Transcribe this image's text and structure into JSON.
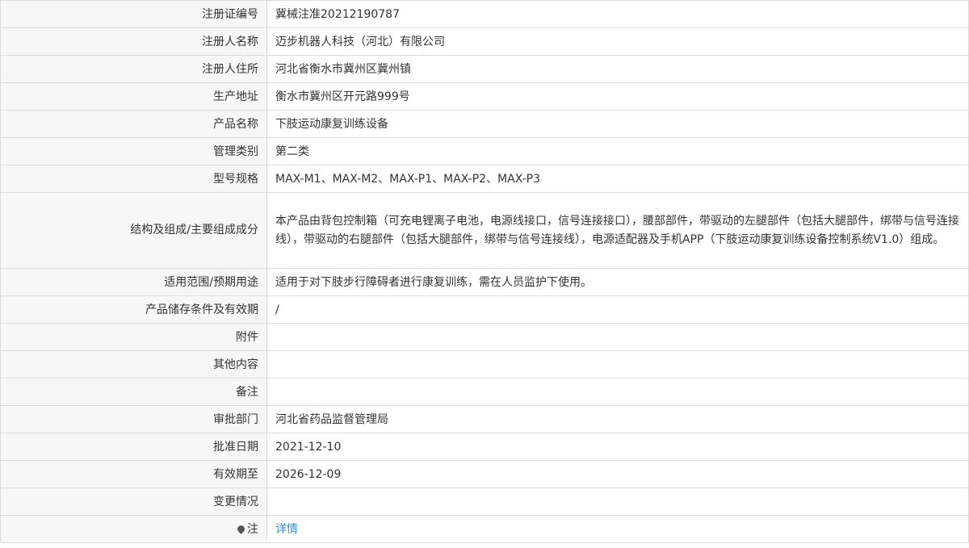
{
  "rows": [
    {
      "label": "注册证编号",
      "value": "冀械注准20212190787"
    },
    {
      "label": "注册人名称",
      "value": "迈步机器人科技（河北）有限公司"
    },
    {
      "label": "注册人住所",
      "value": "河北省衡水市冀州区冀州镇"
    },
    {
      "label": "生产地址",
      "value": "衡水市冀州区开元路999号"
    },
    {
      "label": "产品名称",
      "value": "下肢运动康复训练设备"
    },
    {
      "label": "管理类别",
      "value": "第二类"
    },
    {
      "label": "型号规格",
      "value": "MAX-M1、MAX-M2、MAX-P1、MAX-P2、MAX-P3"
    },
    {
      "label": "结构及组成/主要组成成分",
      "value": "本产品由背包控制箱（可充电锂离子电池，电源线接口，信号连接接口），腰部部件，带驱动的左腿部件（包括大腿部件，绑带与信号连接线），带驱动的右腿部件（包括大腿部件，绑带与信号连接线），电源适配器及手机APP（下肢运动康复训练设备控制系统V1.0）组成。"
    },
    {
      "label": "适用范围/预期用途",
      "value": "适用于对下肢步行障碍者进行康复训练，需在人员监护下使用。"
    },
    {
      "label": "产品储存条件及有效期",
      "value": "/"
    },
    {
      "label": "附件",
      "value": ""
    },
    {
      "label": "其他内容",
      "value": ""
    },
    {
      "label": "备注",
      "value": ""
    },
    {
      "label": "审批部门",
      "value": "河北省药品监督管理局"
    },
    {
      "label": "批准日期",
      "value": "2021-12-10"
    },
    {
      "label": "有效期至",
      "value": "2026-12-09"
    },
    {
      "label": "变更情况",
      "value": ""
    }
  ],
  "note": {
    "label": "注",
    "link_text": "详情",
    "icon": "pin-icon"
  }
}
